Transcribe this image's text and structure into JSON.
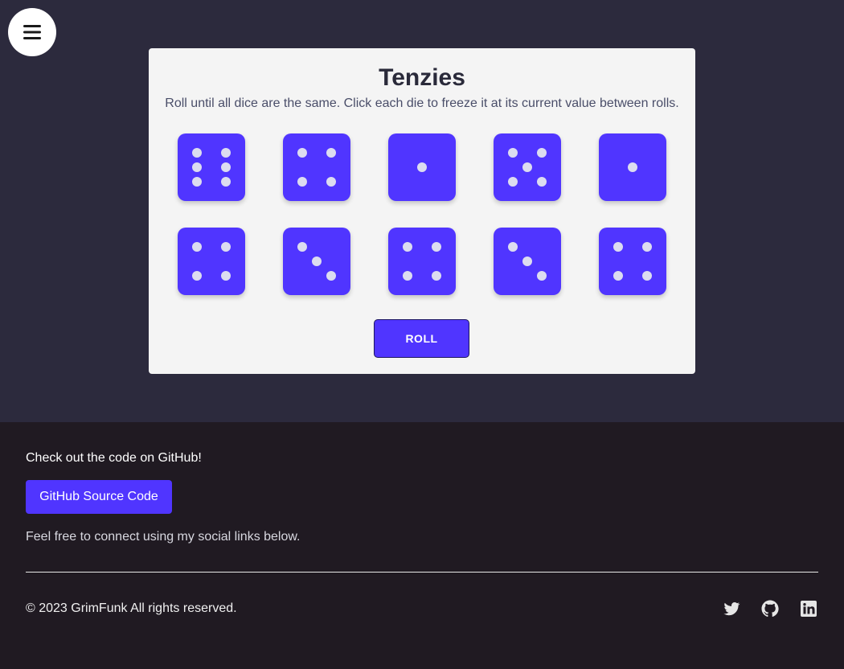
{
  "menu": {
    "icon": "hamburger-menu-icon"
  },
  "game": {
    "title": "Tenzies",
    "subtitle": "Roll until all dice are the same. Click each die to freeze it at its current value between rolls.",
    "dice": [
      6,
      4,
      1,
      5,
      1,
      4,
      3,
      4,
      3,
      4
    ],
    "roll_label": "ROLL",
    "colors": {
      "die": "#5035ff",
      "pip": "#dcdcf0",
      "card": "#f4f4f4"
    }
  },
  "footer": {
    "heading": "Check out the code on GitHub!",
    "github_button_label": "GitHub Source Code",
    "note": "Feel free to connect using my social links below.",
    "copyright": "© 2023 GrimFunk All rights reserved.",
    "social": [
      "twitter-icon",
      "github-icon",
      "linkedin-icon"
    ],
    "colors": {
      "background": "#201a22",
      "accent": "#5035ff"
    }
  }
}
